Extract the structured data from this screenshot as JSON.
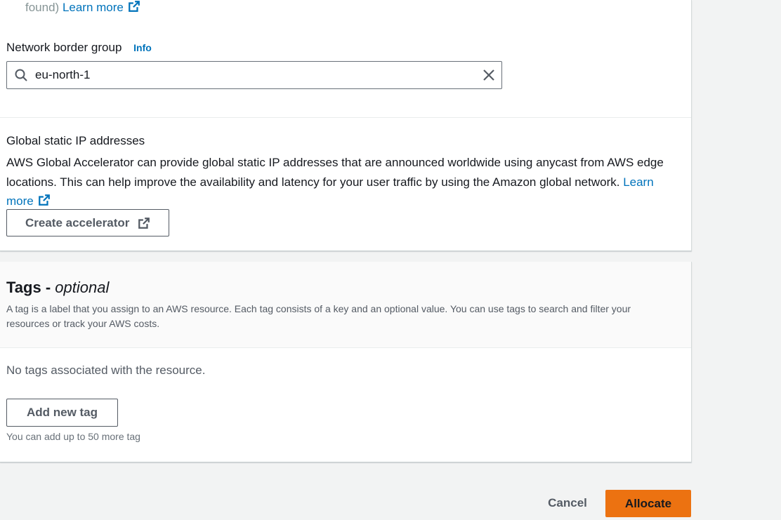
{
  "top": {
    "faded_text": "found)",
    "learn_more": "Learn more"
  },
  "network_border_group": {
    "label": "Network border group",
    "info": "Info",
    "value": "eu-north-1"
  },
  "global_static_ip": {
    "title": "Global static IP addresses",
    "description": "AWS Global Accelerator can provide global static IP addresses that are announced worldwide using anycast from AWS edge locations. This can help improve the availability and latency for your user traffic by using the Amazon global network.",
    "learn_more": "Learn more",
    "create_button": "Create accelerator"
  },
  "tags": {
    "title": "Tags -",
    "title_optional": "optional",
    "description": "A tag is a label that you assign to an AWS resource. Each tag consists of a key and an optional value. You can use tags to search and filter your resources or track your AWS costs.",
    "empty_text": "No tags associated with the resource.",
    "add_button": "Add new tag",
    "limit_text": "You can add up to 50 more tag"
  },
  "footer": {
    "cancel": "Cancel",
    "allocate": "Allocate"
  },
  "colors": {
    "primary": "#ec7211",
    "link": "#0073bb"
  }
}
